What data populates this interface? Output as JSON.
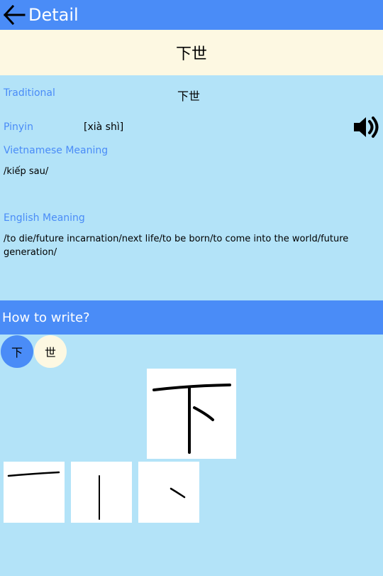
{
  "topbar": {
    "back_icon": "arrow-left-icon",
    "title": "Detail"
  },
  "word": {
    "simplified": "下世",
    "traditional_label": "Traditional",
    "traditional": "下世",
    "pinyin_label": "Pinyin",
    "pinyin": "[xià shì]",
    "speaker_icon": "speaker-icon",
    "vietnamese_label": "Vietnamese Meaning",
    "vietnamese": "/kiếp sau/",
    "english_label": "English Meaning",
    "english": "/to die/future incarnation/next life/to be born/to come into the world/future generation/"
  },
  "writing": {
    "title": "How to write?",
    "characters": [
      "下",
      "世"
    ],
    "selected_index": 0
  },
  "colors": {
    "primary": "#4a8cf7",
    "cream": "#fdf8e2",
    "background": "#b3e3f8",
    "label": "#4a8cf7"
  }
}
